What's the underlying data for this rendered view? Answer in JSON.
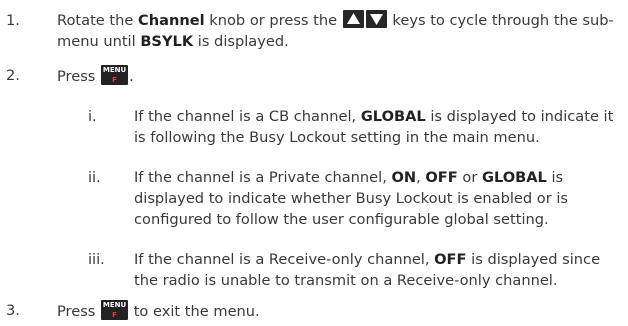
{
  "steps": [
    {
      "num": "1.",
      "t1": "Rotate the ",
      "b1": "Channel",
      "t2": " knob or press the ",
      "t3": " keys to cycle through the sub-menu until ",
      "b2": "BSYLK",
      "t4": " is displayed."
    },
    {
      "num": "2.",
      "t1": "Press ",
      "t2": "."
    },
    {
      "num": "3.",
      "t1": "Press ",
      "t2": " to exit the menu."
    }
  ],
  "substeps": [
    {
      "num": "i.",
      "t1": "If the channel is a CB channel, ",
      "b1": "GLOBAL",
      "t2": " is displayed to indicate it is following the Busy Lockout setting in the main menu."
    },
    {
      "num": "ii.",
      "t1": "If the channel is a Private channel, ",
      "b1": "ON",
      "t2": ", ",
      "b2": "OFF",
      "t3": " or ",
      "b3": "GLOBAL",
      "t4": " is displayed to indicate whether Busy Lockout is enabled or is configured to follow the user configurable global setting."
    },
    {
      "num": "iii.",
      "t1": "If the channel is a Receive-only channel, ",
      "b1": "OFF",
      "t2": " is displayed since the radio is unable to transmit on a Receive-only channel."
    }
  ],
  "keys": {
    "up_icon": "up-arrow-key-icon",
    "down_icon": "down-arrow-key-icon",
    "menu_label": "MENU",
    "menu_fn": "F"
  }
}
